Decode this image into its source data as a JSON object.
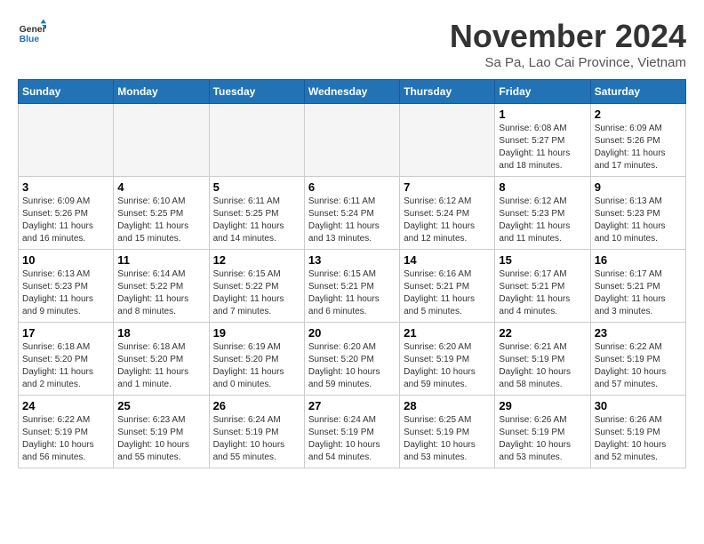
{
  "header": {
    "logo_general": "General",
    "logo_blue": "Blue",
    "title": "November 2024",
    "subtitle": "Sa Pa, Lao Cai Province, Vietnam"
  },
  "calendar": {
    "days_of_week": [
      "Sunday",
      "Monday",
      "Tuesday",
      "Wednesday",
      "Thursday",
      "Friday",
      "Saturday"
    ],
    "weeks": [
      [
        {
          "day": "",
          "info": "",
          "empty": true
        },
        {
          "day": "",
          "info": "",
          "empty": true
        },
        {
          "day": "",
          "info": "",
          "empty": true
        },
        {
          "day": "",
          "info": "",
          "empty": true
        },
        {
          "day": "",
          "info": "",
          "empty": true
        },
        {
          "day": "1",
          "info": "Sunrise: 6:08 AM\nSunset: 5:27 PM\nDaylight: 11 hours and 18 minutes."
        },
        {
          "day": "2",
          "info": "Sunrise: 6:09 AM\nSunset: 5:26 PM\nDaylight: 11 hours and 17 minutes."
        }
      ],
      [
        {
          "day": "3",
          "info": "Sunrise: 6:09 AM\nSunset: 5:26 PM\nDaylight: 11 hours and 16 minutes."
        },
        {
          "day": "4",
          "info": "Sunrise: 6:10 AM\nSunset: 5:25 PM\nDaylight: 11 hours and 15 minutes."
        },
        {
          "day": "5",
          "info": "Sunrise: 6:11 AM\nSunset: 5:25 PM\nDaylight: 11 hours and 14 minutes."
        },
        {
          "day": "6",
          "info": "Sunrise: 6:11 AM\nSunset: 5:24 PM\nDaylight: 11 hours and 13 minutes."
        },
        {
          "day": "7",
          "info": "Sunrise: 6:12 AM\nSunset: 5:24 PM\nDaylight: 11 hours and 12 minutes."
        },
        {
          "day": "8",
          "info": "Sunrise: 6:12 AM\nSunset: 5:23 PM\nDaylight: 11 hours and 11 minutes."
        },
        {
          "day": "9",
          "info": "Sunrise: 6:13 AM\nSunset: 5:23 PM\nDaylight: 11 hours and 10 minutes."
        }
      ],
      [
        {
          "day": "10",
          "info": "Sunrise: 6:13 AM\nSunset: 5:23 PM\nDaylight: 11 hours and 9 minutes."
        },
        {
          "day": "11",
          "info": "Sunrise: 6:14 AM\nSunset: 5:22 PM\nDaylight: 11 hours and 8 minutes."
        },
        {
          "day": "12",
          "info": "Sunrise: 6:15 AM\nSunset: 5:22 PM\nDaylight: 11 hours and 7 minutes."
        },
        {
          "day": "13",
          "info": "Sunrise: 6:15 AM\nSunset: 5:21 PM\nDaylight: 11 hours and 6 minutes."
        },
        {
          "day": "14",
          "info": "Sunrise: 6:16 AM\nSunset: 5:21 PM\nDaylight: 11 hours and 5 minutes."
        },
        {
          "day": "15",
          "info": "Sunrise: 6:17 AM\nSunset: 5:21 PM\nDaylight: 11 hours and 4 minutes."
        },
        {
          "day": "16",
          "info": "Sunrise: 6:17 AM\nSunset: 5:21 PM\nDaylight: 11 hours and 3 minutes."
        }
      ],
      [
        {
          "day": "17",
          "info": "Sunrise: 6:18 AM\nSunset: 5:20 PM\nDaylight: 11 hours and 2 minutes."
        },
        {
          "day": "18",
          "info": "Sunrise: 6:18 AM\nSunset: 5:20 PM\nDaylight: 11 hours and 1 minute."
        },
        {
          "day": "19",
          "info": "Sunrise: 6:19 AM\nSunset: 5:20 PM\nDaylight: 11 hours and 0 minutes."
        },
        {
          "day": "20",
          "info": "Sunrise: 6:20 AM\nSunset: 5:20 PM\nDaylight: 10 hours and 59 minutes."
        },
        {
          "day": "21",
          "info": "Sunrise: 6:20 AM\nSunset: 5:19 PM\nDaylight: 10 hours and 59 minutes."
        },
        {
          "day": "22",
          "info": "Sunrise: 6:21 AM\nSunset: 5:19 PM\nDaylight: 10 hours and 58 minutes."
        },
        {
          "day": "23",
          "info": "Sunrise: 6:22 AM\nSunset: 5:19 PM\nDaylight: 10 hours and 57 minutes."
        }
      ],
      [
        {
          "day": "24",
          "info": "Sunrise: 6:22 AM\nSunset: 5:19 PM\nDaylight: 10 hours and 56 minutes."
        },
        {
          "day": "25",
          "info": "Sunrise: 6:23 AM\nSunset: 5:19 PM\nDaylight: 10 hours and 55 minutes."
        },
        {
          "day": "26",
          "info": "Sunrise: 6:24 AM\nSunset: 5:19 PM\nDaylight: 10 hours and 55 minutes."
        },
        {
          "day": "27",
          "info": "Sunrise: 6:24 AM\nSunset: 5:19 PM\nDaylight: 10 hours and 54 minutes."
        },
        {
          "day": "28",
          "info": "Sunrise: 6:25 AM\nSunset: 5:19 PM\nDaylight: 10 hours and 53 minutes."
        },
        {
          "day": "29",
          "info": "Sunrise: 6:26 AM\nSunset: 5:19 PM\nDaylight: 10 hours and 53 minutes."
        },
        {
          "day": "30",
          "info": "Sunrise: 6:26 AM\nSunset: 5:19 PM\nDaylight: 10 hours and 52 minutes."
        }
      ]
    ]
  }
}
